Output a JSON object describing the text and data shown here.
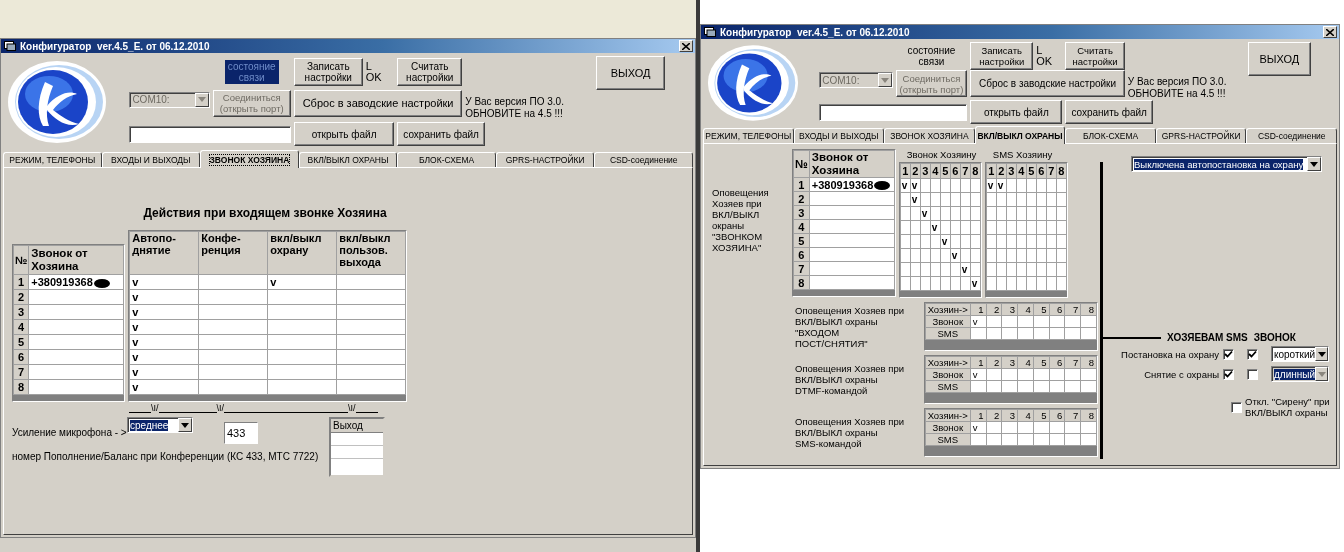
{
  "windows": [
    {
      "title": "Конфигуратор  ver.4.5_E. от 06.12.2010",
      "link_status": {
        "label": "состояние\nсвязи",
        "highlighted": true
      },
      "write_button": "Записать\nнастройки",
      "status_letters": "L\nOK",
      "read_button": "Считать\nнастройки",
      "exit_button": "ВЫХОД",
      "port_select": {
        "value": "COM10:",
        "disabled": true
      },
      "connect_button": {
        "label": "Соединиться\n(открыть порт)",
        "disabled": true
      },
      "reset_button": "Сброс в заводские настройки",
      "version_note": "У Вас версия ПО 3.0.\nОБНОВИТЕ на 4.5 !!!",
      "open_button": "открыть файл",
      "save_button": "сохранить файл",
      "tabs": [
        {
          "label": "РЕЖИМ, ТЕЛЕФОНЫ",
          "selected": false
        },
        {
          "label": "ВХОДЫ И ВЫХОДЫ",
          "selected": false
        },
        {
          "label": "ЗВОНОК ХОЗЯИНА",
          "selected": true
        },
        {
          "label": "ВКЛ/ВЫКЛ ОХРАНЫ",
          "selected": false
        },
        {
          "label": "БЛОК-СХЕМА",
          "selected": false
        },
        {
          "label": "GPRS-НАСТРОЙКИ",
          "selected": false
        },
        {
          "label": "CSD-соединение",
          "selected": false
        }
      ],
      "content": {
        "kind": "owner_call",
        "heading": "Действия при входящем звонке Хозяина",
        "phone_columns": [
          "№",
          "Звонок от\nХозяина"
        ],
        "action_columns": [
          "Автопо-\nднятие",
          "Конфе-\nренция",
          "вкл/выкл\nохрану",
          "вкл/выкл\nпользов.\nвыхода"
        ],
        "rows": [
          {
            "number": "1",
            "phone": "+380919368",
            "redacted": true,
            "col_1": "v",
            "col_3": "v"
          },
          {
            "number": "2",
            "col_1": "v"
          },
          {
            "number": "3",
            "col_1": "v"
          },
          {
            "number": "4",
            "col_1": "v"
          },
          {
            "number": "5",
            "col_1": "v"
          },
          {
            "number": "6",
            "col_1": "v"
          },
          {
            "number": "7",
            "col_1": "v"
          },
          {
            "number": "8",
            "col_1": "v"
          }
        ],
        "dividers": [
          "\\I/",
          "\\I/",
          "\\I/"
        ],
        "mic_label": "Усиление микрофона - >",
        "mic_select": {
          "value": "среднее",
          "highlighted": true
        },
        "balance_field": "433",
        "output_header": "Выход",
        "balance_note": "номер Пополнение/Баланс  при Конференции (КС 433, МТС 7722)"
      }
    },
    {
      "title": "Конфигуратор  ver.4.5_E. от 06.12.2010",
      "link_status": {
        "label": "состояние\nсвязи",
        "highlighted": false
      },
      "write_button": "Записать\nнастройки",
      "status_letters": "L\nOK",
      "read_button": "Считать\nнастройки",
      "exit_button": "ВЫХОД",
      "port_select": {
        "value": "COM10:",
        "disabled": true
      },
      "connect_button": {
        "label": "Соединиться\n(открыть порт)",
        "disabled": true
      },
      "reset_button": "Сброс в заводские настройки",
      "version_note": "У Вас версия ПО 3.0.\nОБНОВИТЕ на 4.5 !!!",
      "open_button": "открыть файл",
      "save_button": "сохранить файл",
      "tabs": [
        {
          "label": "РЕЖИМ, ТЕЛЕФОНЫ",
          "selected": false
        },
        {
          "label": "ВХОДЫ И ВЫХОДЫ",
          "selected": false
        },
        {
          "label": "ЗВОНОК ХОЗЯИНА",
          "selected": false
        },
        {
          "label": "ВКЛ/ВЫКЛ ОХРАНЫ",
          "selected": true
        },
        {
          "label": "БЛОК-СХЕМА",
          "selected": false
        },
        {
          "label": "GPRS-НАСТРОЙКИ",
          "selected": false
        },
        {
          "label": "CSD-соединение",
          "selected": false
        }
      ],
      "content": {
        "kind": "arming",
        "note": "Оповещения\nХозяев при\nВКЛ/ВЫКЛ\nокраны\n\"ЗВОНКОМ\nХОЗЯИНА\"",
        "phone_columns": [
          "№",
          "Звонок от\nХозяина"
        ],
        "rows": [
          {
            "number": "1",
            "phone": "+380919368",
            "redacted": true
          },
          {
            "number": "2"
          },
          {
            "number": "3"
          },
          {
            "number": "4"
          },
          {
            "number": "5"
          },
          {
            "number": "6"
          },
          {
            "number": "7"
          },
          {
            "number": "8"
          }
        ],
        "grids": [
          {
            "title": "Звонок Хозяину",
            "columns": [
              "1",
              "2",
              "3",
              "4",
              "5",
              "6",
              "7",
              "8"
            ],
            "rows": [
              {
                "col_1": "v",
                "col_2": "v"
              },
              {
                "col_2": "v"
              },
              {
                "col_3": "v"
              },
              {
                "col_4": "v"
              },
              {
                "col_5": "v"
              },
              {
                "col_6": "v"
              },
              {
                "col_7": "v"
              },
              {
                "col_8": "v"
              }
            ]
          },
          {
            "title": "SMS Хозяину",
            "columns": [
              "1",
              "2",
              "3",
              "4",
              "5",
              "6",
              "7",
              "8"
            ],
            "rows": [
              {
                "col_1": "v",
                "col_2": "v"
              },
              {},
              {},
              {},
              {},
              {},
              {},
              {}
            ]
          }
        ],
        "notifications": [
          {
            "note": "Оповещения Хозяев при\nВКЛ/ВЫКЛ охраны \"ВХОДОМ\nПОСТ/СНЯТИЯ\"",
            "header": "Хозяин->",
            "columns": [
              "1",
              "2",
              "3",
              "4",
              "5",
              "6",
              "7",
              "8"
            ],
            "rows": [
              {
                "label": "Звонок",
                "col_1": "v"
              },
              {
                "label": "SMS"
              }
            ]
          },
          {
            "note": "Оповещения Хозяев при\nВКЛ/ВЫКЛ охраны\nDTMF-командой",
            "header": "Хозяин->",
            "columns": [
              "1",
              "2",
              "3",
              "4",
              "5",
              "6",
              "7",
              "8"
            ],
            "rows": [
              {
                "label": "Звонок",
                "col_1": "v"
              },
              {
                "label": "SMS"
              }
            ]
          },
          {
            "note": "Оповещения Хозяев при\nВКЛ/ВЫКЛ охраны\nSMS-командой",
            "header": "Хозяин->",
            "columns": [
              "1",
              "2",
              "3",
              "4",
              "5",
              "6",
              "7",
              "8"
            ],
            "rows": [
              {
                "label": "Звонок",
                "col_1": "v"
              },
              {
                "label": "SMS"
              }
            ]
          }
        ],
        "autoarm_select": {
          "value": "Выключена автопостановка на охрану",
          "highlighted": true
        },
        "options_header": [
          "ХОЗЯЕВАМ SMS",
          "ЗВОНОК"
        ],
        "options": [
          {
            "label": "Постановка на охрану",
            "sms": true,
            "call": true,
            "signal": {
              "value": "короткий",
              "highlighted": false,
              "disabled": false
            }
          },
          {
            "label": "Снятие с охраны",
            "sms": true,
            "call": false,
            "signal": {
              "value": "длинный",
              "highlighted": true,
              "disabled": true
            }
          }
        ],
        "siren": {
          "label": "Откл. \"Сирену\" при\nВКЛ/ВЫКЛ охраны",
          "checked": false
        }
      }
    }
  ]
}
